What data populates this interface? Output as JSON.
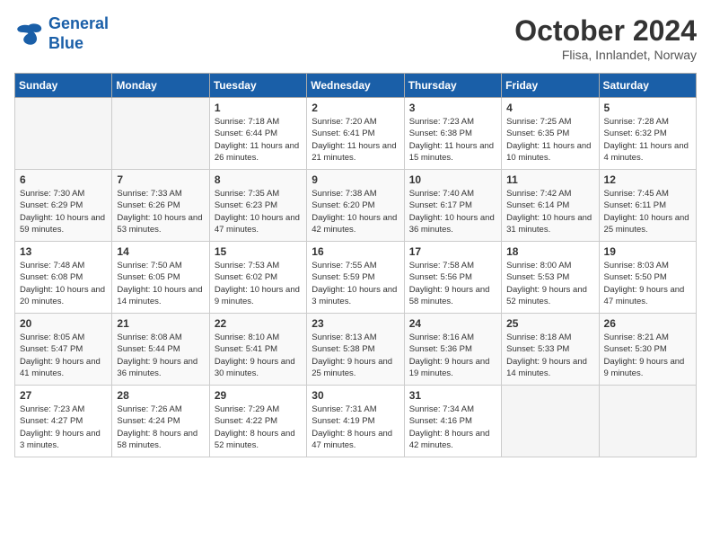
{
  "header": {
    "logo_line1": "General",
    "logo_line2": "Blue",
    "month": "October 2024",
    "location": "Flisa, Innlandet, Norway"
  },
  "days_of_week": [
    "Sunday",
    "Monday",
    "Tuesday",
    "Wednesday",
    "Thursday",
    "Friday",
    "Saturday"
  ],
  "weeks": [
    [
      {
        "day": "",
        "empty": true
      },
      {
        "day": "",
        "empty": true
      },
      {
        "day": "1",
        "sunrise": "Sunrise: 7:18 AM",
        "sunset": "Sunset: 6:44 PM",
        "daylight": "Daylight: 11 hours and 26 minutes."
      },
      {
        "day": "2",
        "sunrise": "Sunrise: 7:20 AM",
        "sunset": "Sunset: 6:41 PM",
        "daylight": "Daylight: 11 hours and 21 minutes."
      },
      {
        "day": "3",
        "sunrise": "Sunrise: 7:23 AM",
        "sunset": "Sunset: 6:38 PM",
        "daylight": "Daylight: 11 hours and 15 minutes."
      },
      {
        "day": "4",
        "sunrise": "Sunrise: 7:25 AM",
        "sunset": "Sunset: 6:35 PM",
        "daylight": "Daylight: 11 hours and 10 minutes."
      },
      {
        "day": "5",
        "sunrise": "Sunrise: 7:28 AM",
        "sunset": "Sunset: 6:32 PM",
        "daylight": "Daylight: 11 hours and 4 minutes."
      }
    ],
    [
      {
        "day": "6",
        "sunrise": "Sunrise: 7:30 AM",
        "sunset": "Sunset: 6:29 PM",
        "daylight": "Daylight: 10 hours and 59 minutes."
      },
      {
        "day": "7",
        "sunrise": "Sunrise: 7:33 AM",
        "sunset": "Sunset: 6:26 PM",
        "daylight": "Daylight: 10 hours and 53 minutes."
      },
      {
        "day": "8",
        "sunrise": "Sunrise: 7:35 AM",
        "sunset": "Sunset: 6:23 PM",
        "daylight": "Daylight: 10 hours and 47 minutes."
      },
      {
        "day": "9",
        "sunrise": "Sunrise: 7:38 AM",
        "sunset": "Sunset: 6:20 PM",
        "daylight": "Daylight: 10 hours and 42 minutes."
      },
      {
        "day": "10",
        "sunrise": "Sunrise: 7:40 AM",
        "sunset": "Sunset: 6:17 PM",
        "daylight": "Daylight: 10 hours and 36 minutes."
      },
      {
        "day": "11",
        "sunrise": "Sunrise: 7:42 AM",
        "sunset": "Sunset: 6:14 PM",
        "daylight": "Daylight: 10 hours and 31 minutes."
      },
      {
        "day": "12",
        "sunrise": "Sunrise: 7:45 AM",
        "sunset": "Sunset: 6:11 PM",
        "daylight": "Daylight: 10 hours and 25 minutes."
      }
    ],
    [
      {
        "day": "13",
        "sunrise": "Sunrise: 7:48 AM",
        "sunset": "Sunset: 6:08 PM",
        "daylight": "Daylight: 10 hours and 20 minutes."
      },
      {
        "day": "14",
        "sunrise": "Sunrise: 7:50 AM",
        "sunset": "Sunset: 6:05 PM",
        "daylight": "Daylight: 10 hours and 14 minutes."
      },
      {
        "day": "15",
        "sunrise": "Sunrise: 7:53 AM",
        "sunset": "Sunset: 6:02 PM",
        "daylight": "Daylight: 10 hours and 9 minutes."
      },
      {
        "day": "16",
        "sunrise": "Sunrise: 7:55 AM",
        "sunset": "Sunset: 5:59 PM",
        "daylight": "Daylight: 10 hours and 3 minutes."
      },
      {
        "day": "17",
        "sunrise": "Sunrise: 7:58 AM",
        "sunset": "Sunset: 5:56 PM",
        "daylight": "Daylight: 9 hours and 58 minutes."
      },
      {
        "day": "18",
        "sunrise": "Sunrise: 8:00 AM",
        "sunset": "Sunset: 5:53 PM",
        "daylight": "Daylight: 9 hours and 52 minutes."
      },
      {
        "day": "19",
        "sunrise": "Sunrise: 8:03 AM",
        "sunset": "Sunset: 5:50 PM",
        "daylight": "Daylight: 9 hours and 47 minutes."
      }
    ],
    [
      {
        "day": "20",
        "sunrise": "Sunrise: 8:05 AM",
        "sunset": "Sunset: 5:47 PM",
        "daylight": "Daylight: 9 hours and 41 minutes."
      },
      {
        "day": "21",
        "sunrise": "Sunrise: 8:08 AM",
        "sunset": "Sunset: 5:44 PM",
        "daylight": "Daylight: 9 hours and 36 minutes."
      },
      {
        "day": "22",
        "sunrise": "Sunrise: 8:10 AM",
        "sunset": "Sunset: 5:41 PM",
        "daylight": "Daylight: 9 hours and 30 minutes."
      },
      {
        "day": "23",
        "sunrise": "Sunrise: 8:13 AM",
        "sunset": "Sunset: 5:38 PM",
        "daylight": "Daylight: 9 hours and 25 minutes."
      },
      {
        "day": "24",
        "sunrise": "Sunrise: 8:16 AM",
        "sunset": "Sunset: 5:36 PM",
        "daylight": "Daylight: 9 hours and 19 minutes."
      },
      {
        "day": "25",
        "sunrise": "Sunrise: 8:18 AM",
        "sunset": "Sunset: 5:33 PM",
        "daylight": "Daylight: 9 hours and 14 minutes."
      },
      {
        "day": "26",
        "sunrise": "Sunrise: 8:21 AM",
        "sunset": "Sunset: 5:30 PM",
        "daylight": "Daylight: 9 hours and 9 minutes."
      }
    ],
    [
      {
        "day": "27",
        "sunrise": "Sunrise: 7:23 AM",
        "sunset": "Sunset: 4:27 PM",
        "daylight": "Daylight: 9 hours and 3 minutes."
      },
      {
        "day": "28",
        "sunrise": "Sunrise: 7:26 AM",
        "sunset": "Sunset: 4:24 PM",
        "daylight": "Daylight: 8 hours and 58 minutes."
      },
      {
        "day": "29",
        "sunrise": "Sunrise: 7:29 AM",
        "sunset": "Sunset: 4:22 PM",
        "daylight": "Daylight: 8 hours and 52 minutes."
      },
      {
        "day": "30",
        "sunrise": "Sunrise: 7:31 AM",
        "sunset": "Sunset: 4:19 PM",
        "daylight": "Daylight: 8 hours and 47 minutes."
      },
      {
        "day": "31",
        "sunrise": "Sunrise: 7:34 AM",
        "sunset": "Sunset: 4:16 PM",
        "daylight": "Daylight: 8 hours and 42 minutes."
      },
      {
        "day": "",
        "empty": true
      },
      {
        "day": "",
        "empty": true
      }
    ]
  ]
}
